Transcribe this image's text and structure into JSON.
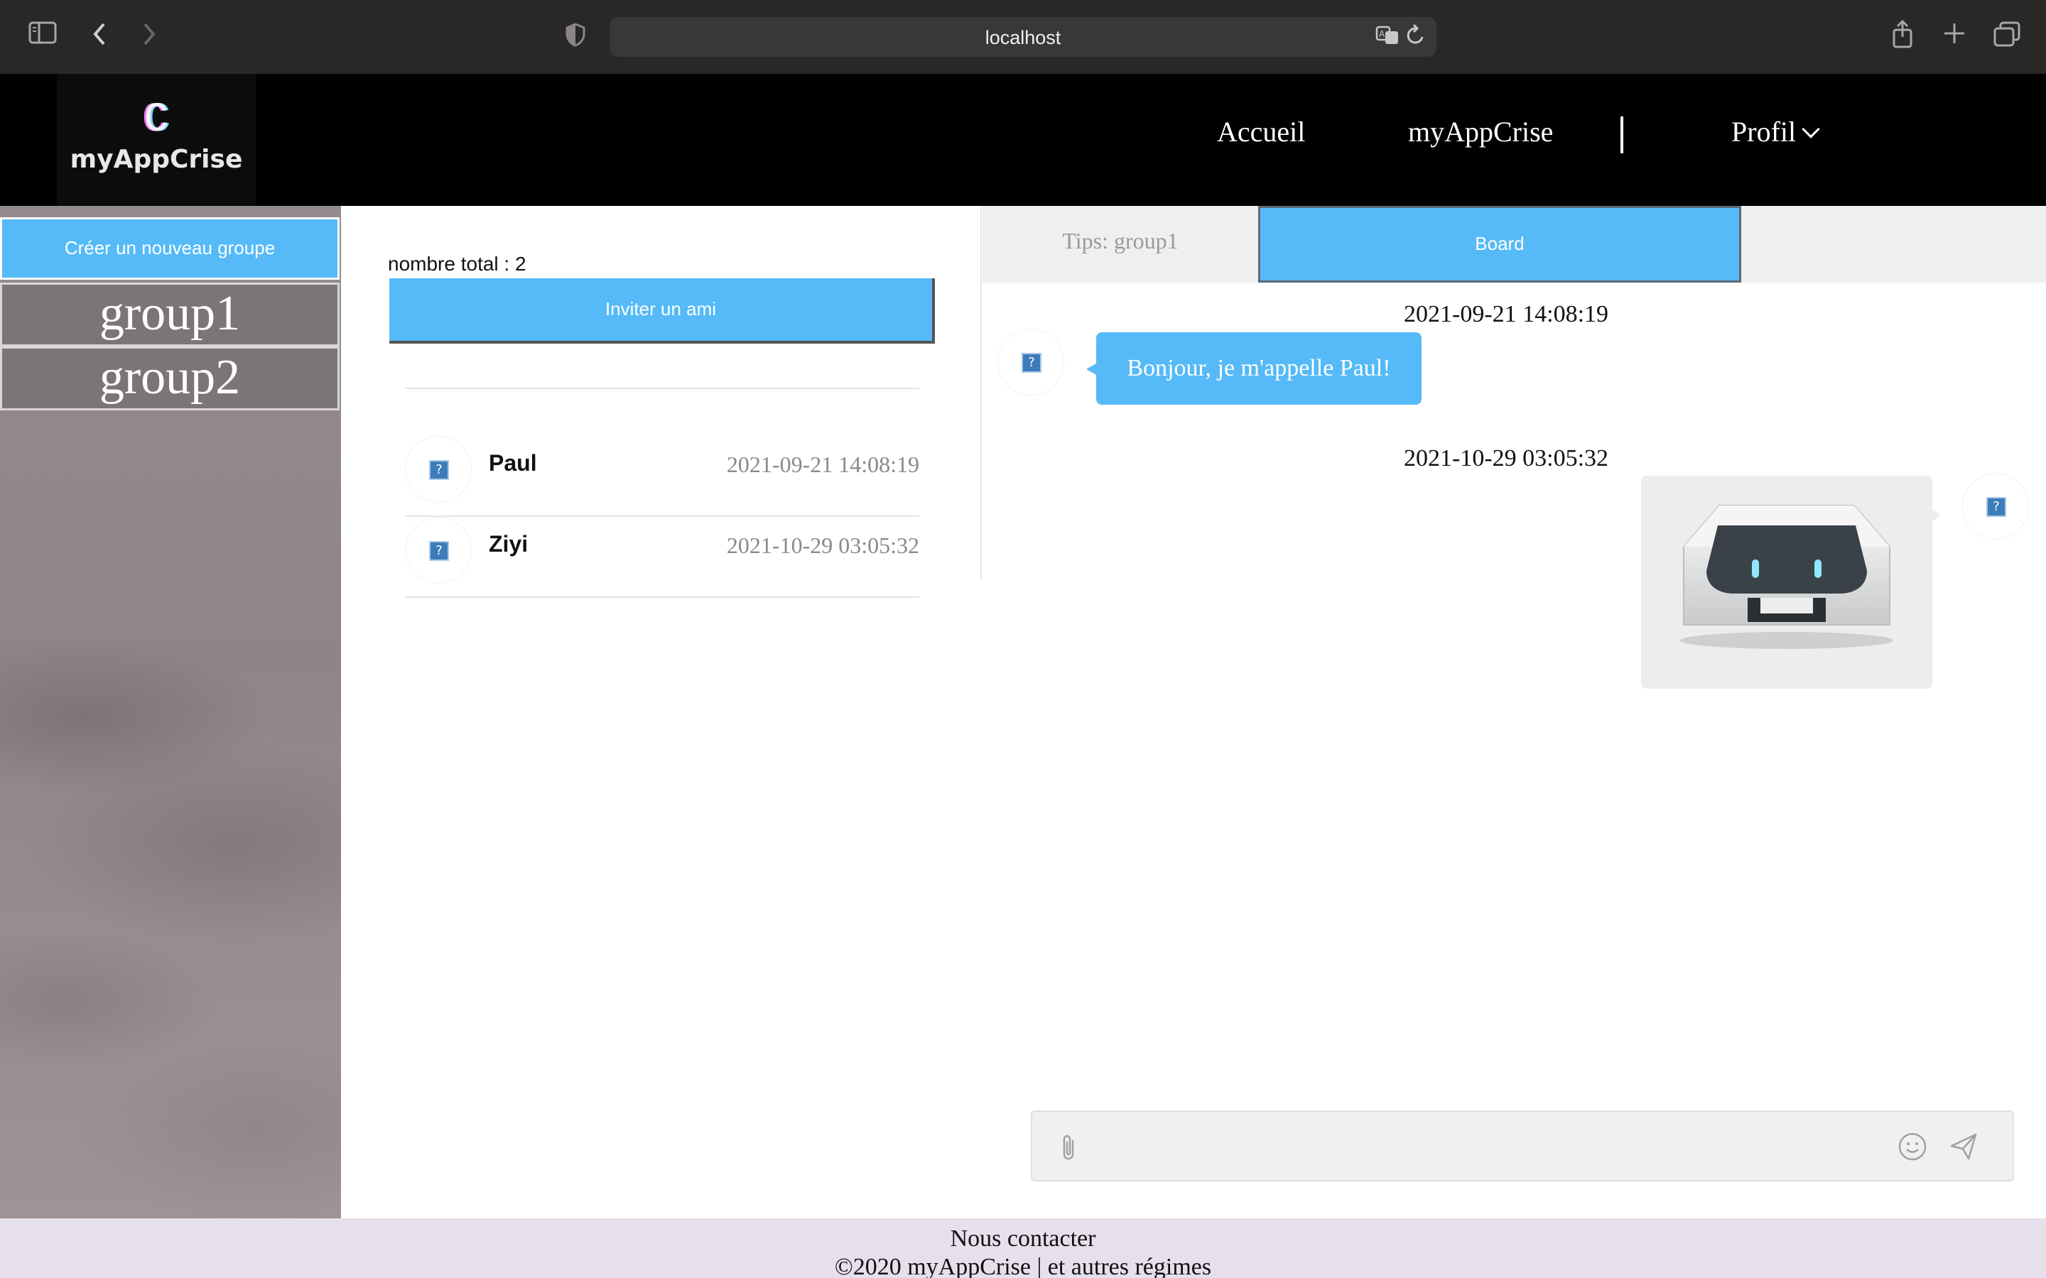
{
  "browser": {
    "url": "localhost",
    "icons": [
      "sidebar-toggle-icon",
      "back-icon",
      "forward-icon",
      "shield-icon",
      "translate-icon",
      "reload-icon",
      "share-icon",
      "new-tab-icon",
      "tabs-overview-icon"
    ]
  },
  "header": {
    "logo_mark": "C",
    "logo_name": "myAppCrise",
    "nav": {
      "home": "Accueil",
      "app": "myAppCrise",
      "profile": "Profil"
    }
  },
  "sidebar": {
    "create_group_label": "Créer un nouveau groupe",
    "groups": [
      {
        "label": "group1"
      },
      {
        "label": "group2"
      }
    ]
  },
  "members": {
    "total_label": "nombre total : 2",
    "invite_label": "Inviter un ami",
    "list": [
      {
        "name": "Paul",
        "time": "2021-09-21 14:08:19"
      },
      {
        "name": "Ziyi",
        "time": "2021-10-29 03:05:32"
      }
    ]
  },
  "chat": {
    "tabs": {
      "tips": "Tips: group1",
      "board": "Board"
    },
    "active_tab": "Board",
    "messages": [
      {
        "time": "2021-09-21 14:08:19",
        "text": "Bonjour, je m'appelle Paul!",
        "side": "left",
        "type": "text"
      },
      {
        "time": "2021-10-29 03:05:32",
        "text": "",
        "side": "right",
        "type": "image",
        "image": "robot-box-image"
      }
    ],
    "composer": {
      "value": "",
      "placeholder": "",
      "icons": [
        "paperclip-icon",
        "emoji-icon",
        "send-icon"
      ]
    }
  },
  "footer": {
    "contact": "Nous contacter",
    "copyright": "©2020 myAppCrise | et autres régimes"
  },
  "colors": {
    "accent": "#55baf7",
    "header_bg": "#000000",
    "footer_bg": "#e6dfec",
    "chrome_bg": "#2a2727"
  }
}
